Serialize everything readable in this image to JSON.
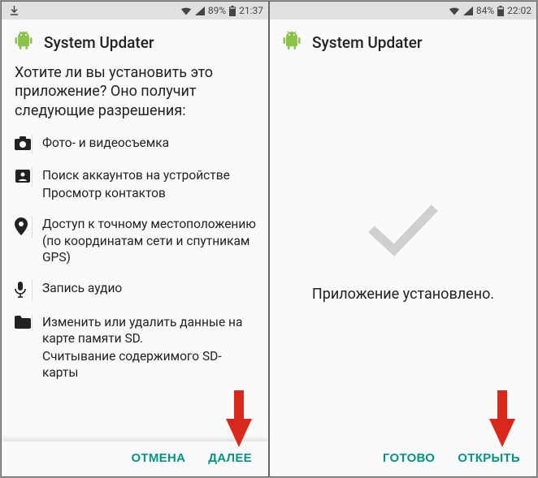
{
  "left": {
    "status": {
      "battery": "89%",
      "time": "21:37"
    },
    "app_title": "System Updater",
    "prompt": "Хотите ли вы установить это приложение? Оно получит следующие разрешения:",
    "permissions": [
      {
        "icon": "camera",
        "lines": [
          "Фото- и видеосъемка"
        ]
      },
      {
        "icon": "contacts",
        "lines": [
          "Поиск аккаунтов на устройстве",
          "Просмотр контактов"
        ]
      },
      {
        "icon": "location",
        "lines": [
          "Доступ к точному местоположению (по координатам сети и спутникам GPS)"
        ]
      },
      {
        "icon": "mic",
        "lines": [
          "Запись аудио"
        ]
      },
      {
        "icon": "folder",
        "lines": [
          "Изменить или удалить данные на карте памяти SD.",
          "Считывание содержимого SD-карты"
        ]
      }
    ],
    "buttons": {
      "cancel": "ОТМЕНА",
      "next": "ДАЛЕЕ"
    }
  },
  "right": {
    "status": {
      "battery": "84%",
      "time": "22:02"
    },
    "app_title": "System Updater",
    "installed": "Приложение установлено.",
    "buttons": {
      "done": "ГОТОВО",
      "open": "ОТКРЫТЬ"
    }
  }
}
